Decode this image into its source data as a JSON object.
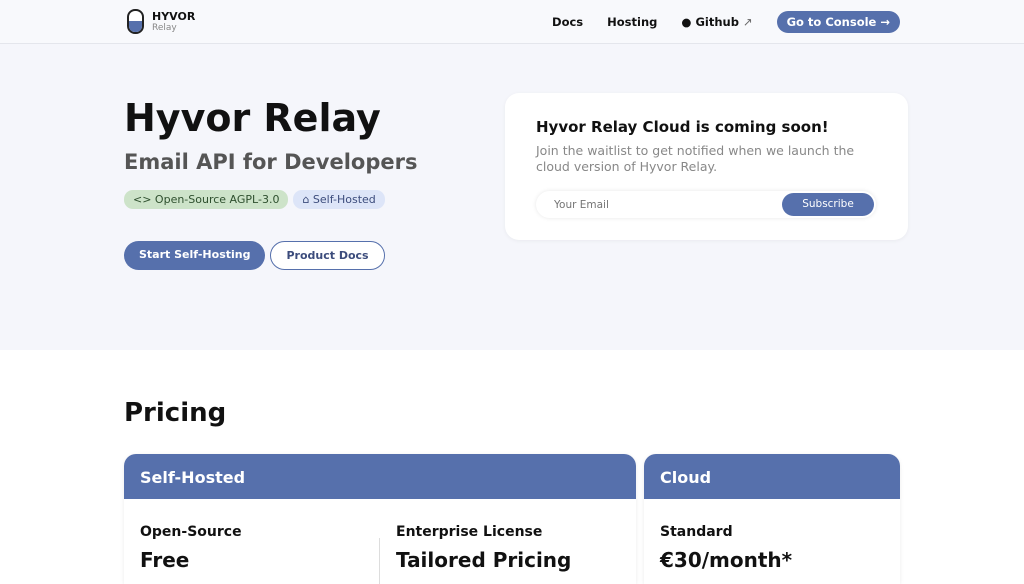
{
  "header": {
    "brand": "HYVOR",
    "product": "Relay",
    "nav": [
      "Docs",
      "Hosting",
      "Github"
    ],
    "console": "Go to Console →"
  },
  "hero": {
    "title": "Hyvor Relay",
    "subtitle": "Email API for Developers",
    "badges": [
      "<> Open-Source AGPL-3.0",
      "⌂ Self-Hosted"
    ],
    "buttons": [
      "Start Self-Hosting",
      "Product Docs"
    ]
  },
  "waitlist": {
    "title": "Hyvor Relay Cloud is coming soon!",
    "text": "Join the waitlist to get notified when we launch the cloud version of Hyvor Relay.",
    "placeholder": "Your Email",
    "button": "Subscribe"
  },
  "pricing": {
    "title": "Pricing",
    "self": {
      "title": "Self-Hosted",
      "plans": [
        {
          "name": "Open-Source",
          "price": "Free"
        },
        {
          "name": "Enterprise License",
          "price": "Tailored Pricing"
        }
      ]
    },
    "cloud": {
      "title": "Cloud",
      "plans": [
        {
          "name": "Standard",
          "price": "€30/month*"
        }
      ]
    }
  },
  "colors": {
    "primary": "#5670ac"
  }
}
